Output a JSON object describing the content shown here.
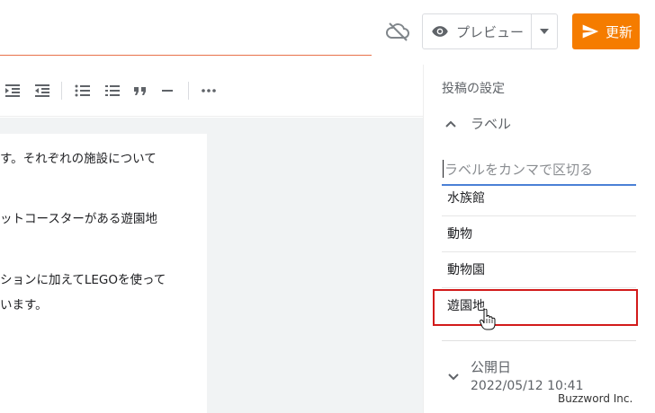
{
  "header": {
    "cloud_icon": "cloud-off-icon",
    "preview_label": "プレビュー",
    "update_label": "更新",
    "accent_color": "#f57c00"
  },
  "toolbar": {
    "icons": [
      "indent-increase-icon",
      "indent-decrease-icon",
      "bulleted-list-icon",
      "numbered-list-icon",
      "quote-icon",
      "horizontal-rule-icon",
      "more-icon"
    ]
  },
  "editor": {
    "paragraphs": [
      "す。それぞれの施設について",
      "ットコースターがある遊園地",
      "ションに加えてLEGOを使って",
      "います。"
    ]
  },
  "panel": {
    "title": "投稿の設定",
    "labels_section": "ラベル",
    "label_input_placeholder": "ラベルをカンマで区切る",
    "suggestions": [
      "水族館",
      "動物",
      "動物園",
      "遊園地"
    ],
    "date_section": "公開日",
    "date_value": "2022/05/12 10:41"
  },
  "watermark": "Buzzword Inc."
}
